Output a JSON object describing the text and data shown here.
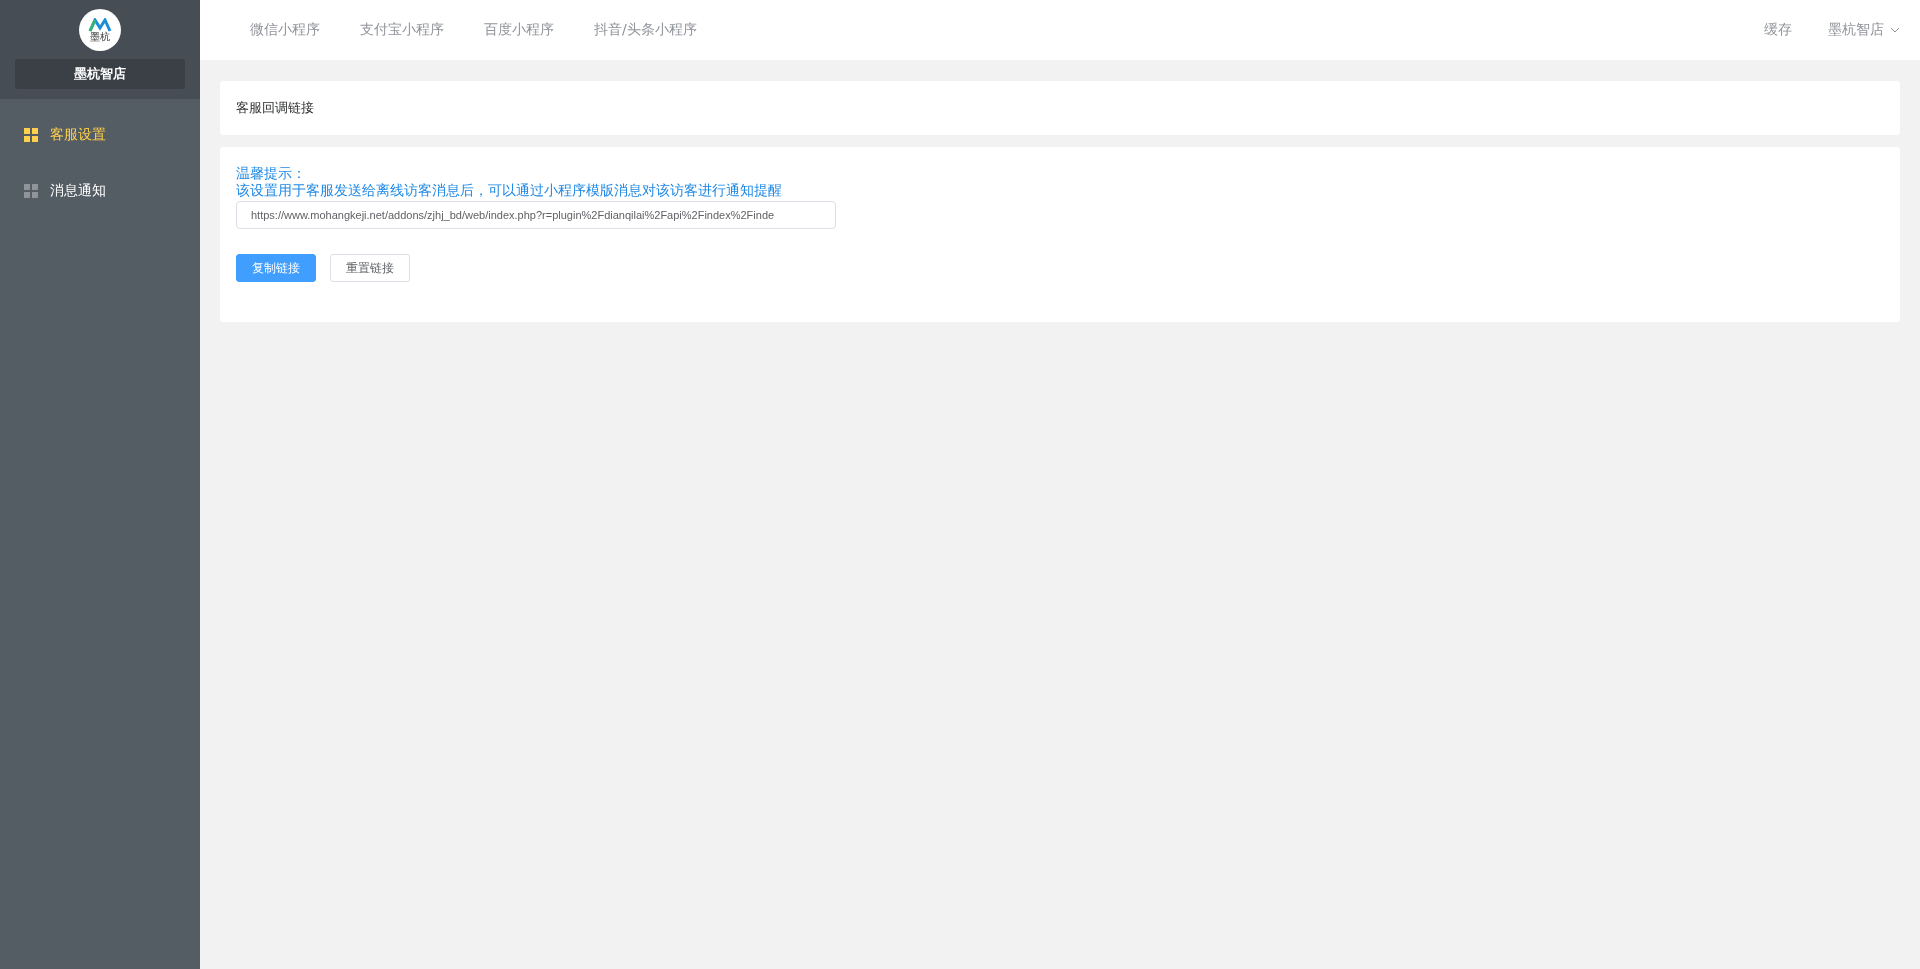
{
  "sidebar": {
    "logo_text": "墨杭",
    "store_name": "墨杭智店",
    "items": [
      {
        "label": "客服设置",
        "selected": true
      },
      {
        "label": "消息通知",
        "selected": false
      }
    ]
  },
  "top_nav": {
    "tabs": [
      {
        "label": "微信小程序"
      },
      {
        "label": "支付宝小程序"
      },
      {
        "label": "百度小程序"
      },
      {
        "label": "抖音/头条小程序"
      }
    ],
    "cache": "缓存",
    "account": "墨杭智店"
  },
  "header_card": {
    "title": "客服回调链接"
  },
  "content": {
    "tip_title": "温馨提示：",
    "tip_text": "该设置用于客服发送给离线访客消息后，可以通过小程序模版消息对该访客进行通知提醒",
    "link_value": "https://www.mohangkeji.net/addons/zjhj_bd/web/index.php?r=plugin%2Fdianqilai%2Fapi%2Findex%2Finde",
    "buttons": [
      {
        "label": "复制链接",
        "kind": "primary"
      },
      {
        "label": "重置链接",
        "kind": "default"
      }
    ]
  }
}
